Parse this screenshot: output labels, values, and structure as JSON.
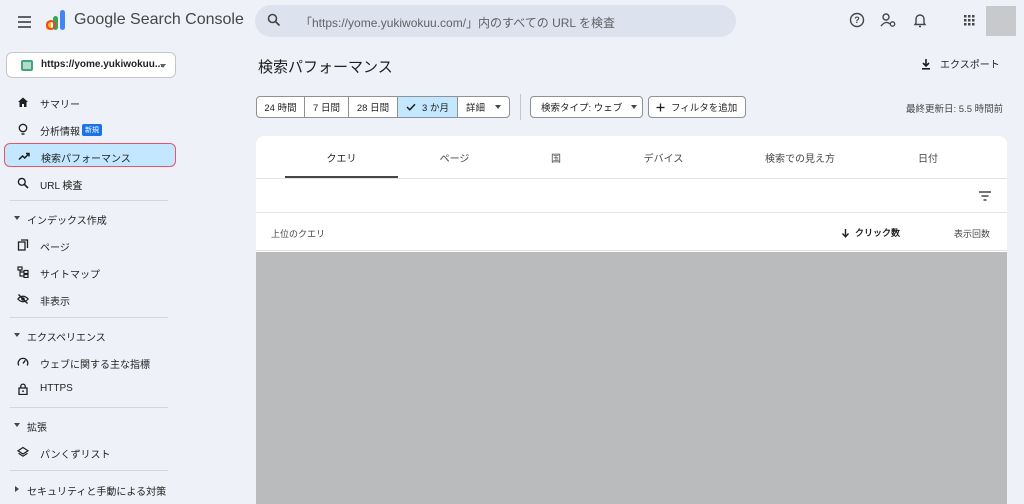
{
  "header": {
    "app_name": "Google Search Console",
    "search_placeholder": "「https://yome.yukiwokuu.com/」内のすべての URL を検査"
  },
  "property": {
    "label": "https://yome.yukiwokuu...",
    "color": "#43a57c"
  },
  "sidebar": {
    "items": [
      {
        "label": "サマリー",
        "icon": "home-icon"
      },
      {
        "label": "分析情報",
        "icon": "lightbulb-icon",
        "badge": "新規"
      },
      {
        "label": "検索パフォーマンス",
        "icon": "trending-up-icon",
        "active": true
      },
      {
        "label": "URL 検査",
        "icon": "search-icon"
      }
    ],
    "sections": [
      {
        "title": "インデックス作成",
        "items": [
          {
            "label": "ページ",
            "icon": "pages-icon"
          },
          {
            "label": "サイトマップ",
            "icon": "sitemap-icon"
          },
          {
            "label": "非表示",
            "icon": "visibility-off-icon"
          }
        ]
      },
      {
        "title": "エクスペリエンス",
        "items": [
          {
            "label": "ウェブに関する主な指標",
            "icon": "speed-icon"
          },
          {
            "label": "HTTPS",
            "icon": "lock-icon"
          }
        ]
      },
      {
        "title": "拡張",
        "items": [
          {
            "label": "パンくずリスト",
            "icon": "layers-icon"
          }
        ]
      },
      {
        "title": "セキュリティと手動による対策",
        "items": []
      }
    ]
  },
  "main": {
    "title": "検索パフォーマンス",
    "export_label": "エクスポート",
    "date_ranges": [
      "24 時間",
      "7 日間",
      "28 日間",
      "3 か月",
      "詳細"
    ],
    "selected_range": "3 か月",
    "search_type_label": "検索タイプ: ウェブ",
    "add_filter_label": "フィルタを追加",
    "last_updated": "最終更新日: 5.5 時間前",
    "tabs": [
      "クエリ",
      "ページ",
      "国",
      "デバイス",
      "検索での見え方",
      "日付"
    ],
    "selected_tab": "クエリ",
    "table": {
      "col_query": "上位のクエリ",
      "col_clicks": "クリック数",
      "col_impressions": "表示回数"
    }
  },
  "colors": {
    "accent": "#c2e7ff",
    "highlight_border": "#e8546a",
    "redacted": "#b9bbbd"
  }
}
